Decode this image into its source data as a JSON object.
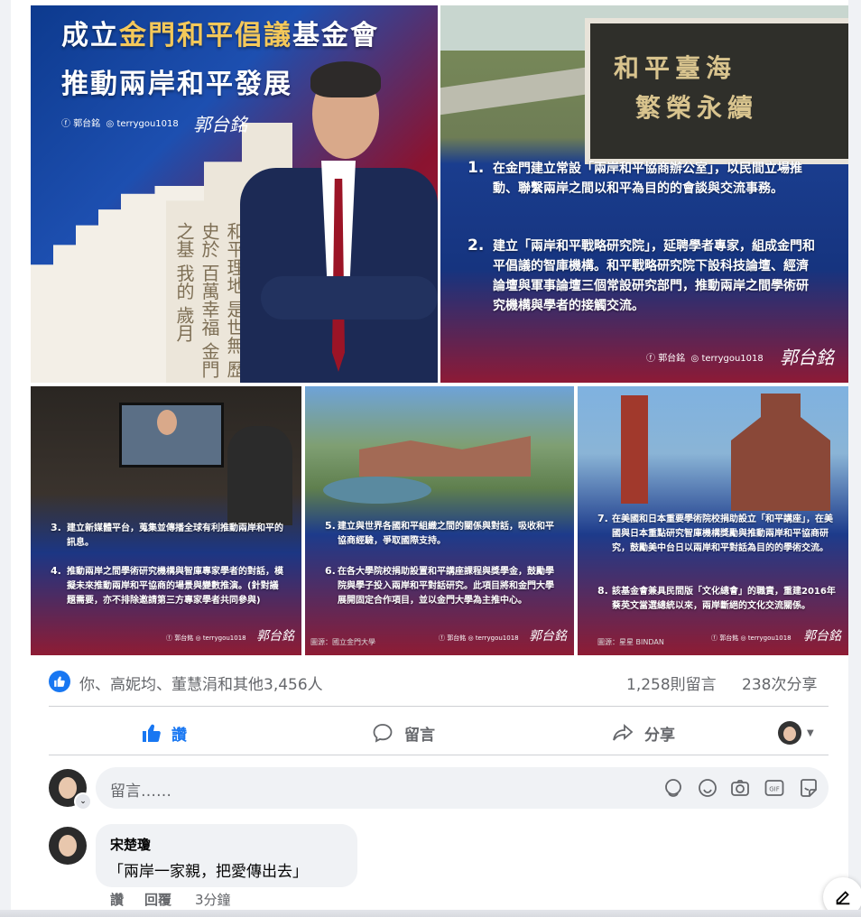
{
  "post_images": {
    "img1": {
      "line1_pre": "成立",
      "line1_gold": "金門和平倡議",
      "line1_post": "基金會",
      "line2": "推動兩岸和平發展",
      "fb": "郭台銘",
      "ig": "terrygou1018",
      "sig": "郭台銘",
      "wall_text": [
        "和平理地",
        "是世無",
        "歷史於",
        "百萬幸福",
        "金門之基",
        "我的",
        "歲月"
      ]
    },
    "img2": {
      "plaque_line1": "和平臺海",
      "plaque_line2": "繁榮永續",
      "p1_num": "1.",
      "p1": "在金門建立常設「兩岸和平協商辦公室」，以民間立場推動、聯繫兩岸之間以和平為目的的會談與交流事務。",
      "p2_num": "2.",
      "p2": "建立「兩岸和平戰略研究院」，延聘學者專家，組成金門和平倡議的智庫機構。和平戰略研究院下設科技論壇、經濟論壇與軍事論壇三個常設研究部門，推動兩岸之間學術研究機構與學者的接觸交流。",
      "fb": "郭台銘",
      "ig": "terrygou1018",
      "sig": "郭台銘"
    },
    "img3": {
      "p3_num": "3.",
      "p3": "建立新媒體平台，蒐集並傳播全球有利推動兩岸和平的訊息。",
      "p4_num": "4.",
      "p4": "推動兩岸之間學術研究機構與智庫專家學者的對話，模擬未來推動兩岸和平協商的場景與變數推演。(針對議題需要，亦不排除邀請第三方專家學者共同參與)",
      "fb": "郭台銘",
      "ig": "terrygou1018",
      "sig": "郭台銘"
    },
    "img4": {
      "p5_num": "5.",
      "p5": "建立與世界各國和平組織之間的關係與對話，吸收和平協商經驗，爭取國際支持。",
      "p6_num": "6.",
      "p6": "在各大學院校捐助設置和平講座課程與獎學金，鼓勵學院與學子投入兩岸和平對話研究。此項目將和金門大學展開固定合作項目，並以金門大學為主推中心。",
      "credit": "圖源：國立金門大學",
      "fb": "郭台銘",
      "ig": "terrygou1018",
      "sig": "郭台銘"
    },
    "img5": {
      "p7_num": "7.",
      "p7": "在美國和日本重要學術院校捐助設立「和平講座」，在美國與日本重點研究智庫機構獎勵與推動兩岸和平協商研究，鼓勵美中台日以兩岸和平對話為目的的學術交流。",
      "p8_num": "8.",
      "p8": "該基金會兼具民間版「文化總會」的職責，重建2016年蔡英文當選總統以來，兩岸斷絕的文化交流關係。",
      "credit": "圖源：星星 BINDAN",
      "fb": "郭台銘",
      "ig": "terrygou1018",
      "sig": "郭台銘"
    }
  },
  "reactions": {
    "names": "你、高妮均、董慧涓和其他3,456人",
    "comments": "1,258則留言",
    "shares": "238次分享"
  },
  "actions": {
    "like": "讚",
    "comment": "留言",
    "share": "分享"
  },
  "comment_box": {
    "placeholder": "留言……"
  },
  "comment": {
    "author": "宋楚瓊",
    "text": "「兩岸一家親，把愛傳出去」",
    "like": "讚",
    "reply": "回覆",
    "time": "3分鐘"
  },
  "colors": {
    "facebook_blue": "#1877f2",
    "meta_gray": "#65676b",
    "input_bg": "#f0f2f5"
  }
}
